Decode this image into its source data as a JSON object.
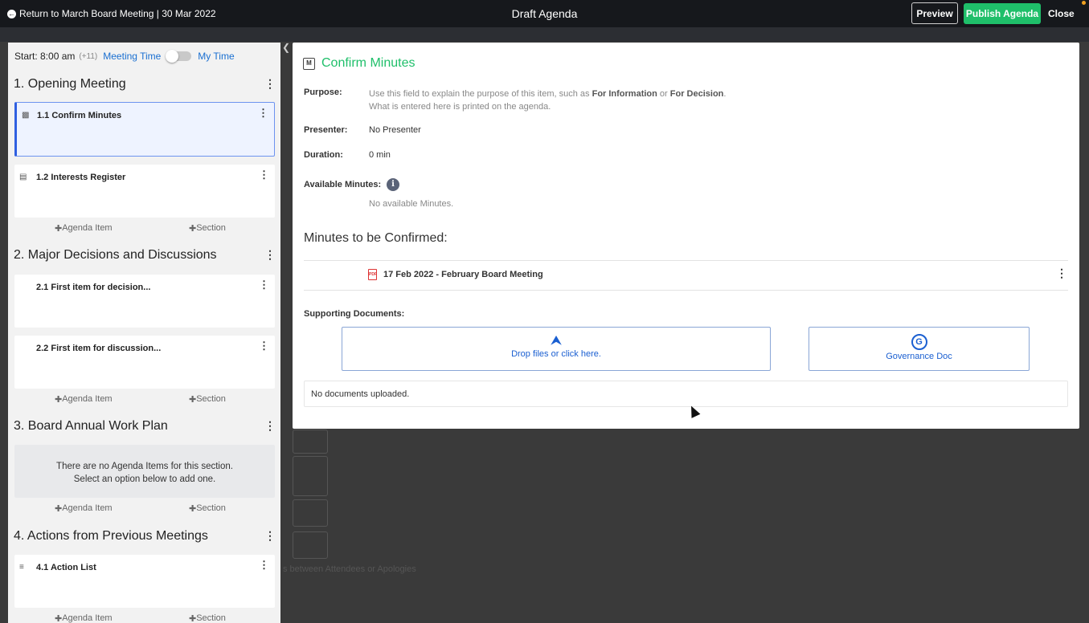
{
  "header": {
    "back_label": "Return to March Board Meeting | 30 Mar 2022",
    "title": "Draft Agenda",
    "preview_label": "Preview",
    "publish_label": "Publish Agenda",
    "close_label": "Close"
  },
  "timebar": {
    "start": "Start: 8:00 am",
    "offset": "(+11)",
    "meeting_time": "Meeting Time",
    "my_time": "My Time"
  },
  "sections": [
    {
      "title": "1. Opening Meeting",
      "items": [
        "1.1 Confirm Minutes",
        "1.2 Interests Register"
      ]
    },
    {
      "title": "2. Major Decisions and Discussions",
      "items": [
        "2.1 First item for decision...",
        "2.2 First item for discussion..."
      ]
    },
    {
      "title": "3. Board Annual Work Plan",
      "empty_line1": "There are no Agenda Items for this section.",
      "empty_line2": "Select an option below to add one."
    },
    {
      "title": "4. Actions from Previous Meetings",
      "items": [
        "4.1 Action List"
      ]
    }
  ],
  "adders": {
    "agenda_item": "Agenda Item",
    "section": "Section"
  },
  "panel": {
    "title": "Confirm Minutes",
    "purpose_label": "Purpose:",
    "purpose_line1_a": "Use this field to explain the purpose of this item, such as ",
    "purpose_bold1": "For Information",
    "purpose_or": " or ",
    "purpose_bold2": "For Decision",
    "purpose_end": ".",
    "purpose_line2": "What is entered here is printed on the agenda.",
    "presenter_label": "Presenter:",
    "presenter_value": "No Presenter",
    "duration_label": "Duration:",
    "duration_value": "0 min",
    "available_label": "Available Minutes:",
    "available_value": "No available Minutes.",
    "minutes_heading": "Minutes to be Confirmed:",
    "minutes_doc": "17 Feb 2022 - February Board Meeting",
    "supporting_label": "Supporting Documents:",
    "drop_label": "Drop files or click here.",
    "gov_label": "Governance Doc",
    "no_docs": "No documents uploaded."
  },
  "background": {
    "hint_text": "s between Attendees or Apologies"
  },
  "colors": {
    "accent_green": "#1fbf6a",
    "link_blue": "#1a6fd1",
    "active_border": "#2f5fe0"
  },
  "icons": [
    "back-arrow-icon",
    "minutes-icon",
    "register-icon",
    "action-list-icon",
    "pdf-icon",
    "info-icon",
    "upload-icon",
    "governance-icon",
    "kebab-icon",
    "chevron-left-icon"
  ]
}
